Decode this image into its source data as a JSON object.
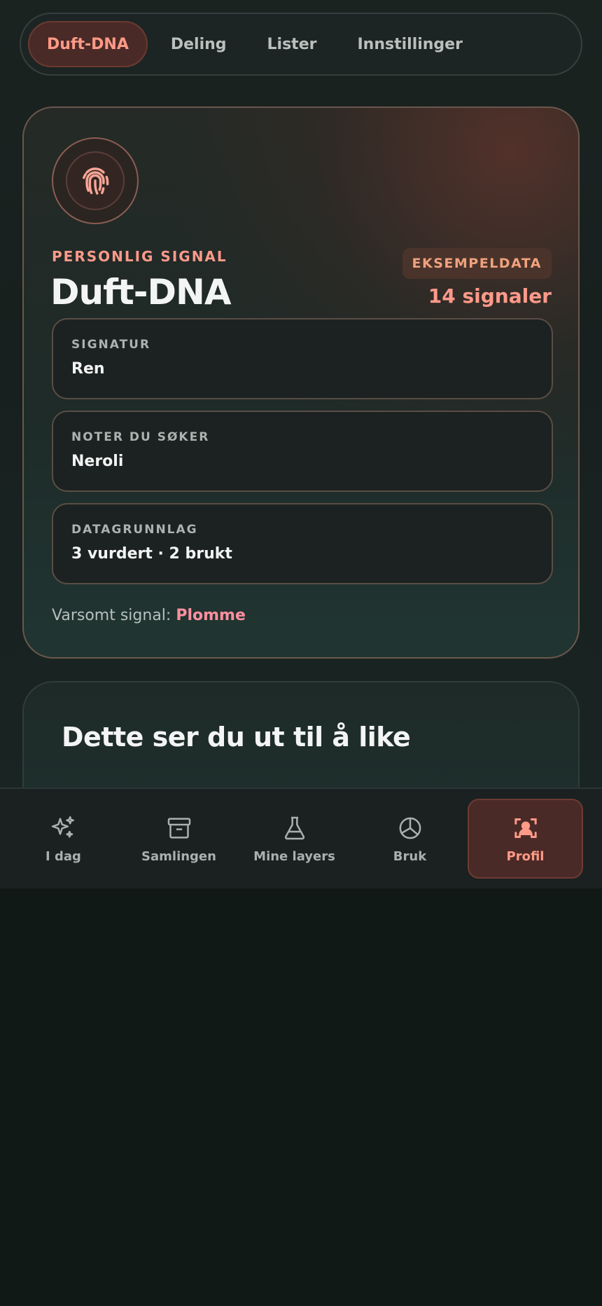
{
  "top_tabs": [
    {
      "label": "Duft-DNA",
      "active": true
    },
    {
      "label": "Deling",
      "active": false
    },
    {
      "label": "Lister",
      "active": false
    },
    {
      "label": "Innstillinger",
      "active": false
    }
  ],
  "dna_card": {
    "icon": "fingerprint-icon",
    "eyebrow": "PERSONLIG SIGNAL",
    "title": "Duft-DNA",
    "sample_badge": "EKSEMPELDATA",
    "signal_count": "14 signaler",
    "boxes": [
      {
        "label": "SIGNATUR",
        "value": "Ren"
      },
      {
        "label": "NOTER DU SØKER",
        "value": "Neroli"
      },
      {
        "label": "DATAGRUNNLAG",
        "value": "3 vurdert · 2 brukt"
      }
    ],
    "warning_prefix": "Varsomt signal:",
    "warning_value": "Plomme"
  },
  "likes_card": {
    "title": "Dette ser du ut til å like"
  },
  "bottom_nav": [
    {
      "label": "I dag",
      "icon": "sparkles-icon",
      "active": false
    },
    {
      "label": "Samlingen",
      "icon": "archive-box-icon",
      "active": false
    },
    {
      "label": "Mine layers",
      "icon": "flask-icon",
      "active": false
    },
    {
      "label": "Bruk",
      "icon": "chart-pie-icon",
      "active": false
    },
    {
      "label": "Profil",
      "icon": "user-focus-icon",
      "active": true
    }
  ],
  "colors": {
    "accent": "#ff9a87",
    "background": "#111917",
    "active_bg": "#4a2a27"
  }
}
